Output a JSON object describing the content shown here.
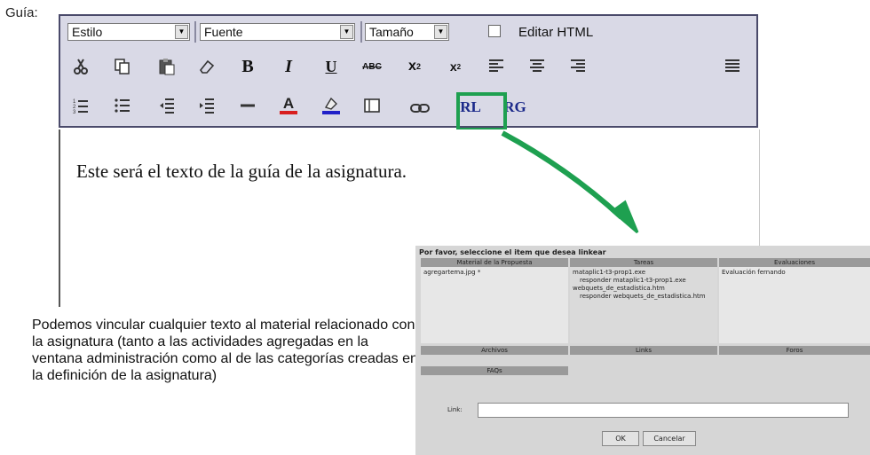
{
  "guia_label": "Guía:",
  "toolbar": {
    "style_select": "Estilo",
    "font_select": "Fuente",
    "size_select": "Tamaño",
    "edit_html_label": "Editar HTML",
    "edit_html_checked": false,
    "row1_icons": [
      "cut-icon",
      "copy-icon",
      "paste-icon",
      "eraser-icon",
      "bold-icon",
      "italic-icon",
      "underline-icon",
      "strikethrough-icon",
      "superscript-icon",
      "subscript-icon",
      "align-left-icon",
      "align-center-icon",
      "align-right-icon",
      "justify-icon"
    ],
    "row2_icons": [
      "numbered-list-icon",
      "bullet-list-icon",
      "outdent-icon",
      "indent-icon",
      "horizontal-rule-icon",
      "font-color-icon",
      "highlight-color-icon",
      "table-icon",
      "link-icon",
      "insert-resource-rl-icon",
      "insert-resource-rg-icon"
    ],
    "glyphs": {
      "bold": "B",
      "italic": "I",
      "underline": "U",
      "strike": "ABC",
      "sup_base": "x",
      "sup": "2",
      "sub_base": "x",
      "sub": "2",
      "font_color": "A",
      "rl": "RL",
      "rg": "RG"
    },
    "highlight_color": "#1ea050"
  },
  "content_text": "Este será el texto de la guía de la asignatura.",
  "caption": "Podemos vincular cualquier texto al material relacionado con la asignatura (tanto a las actividades agregadas en la ventana administración como al de las categorías creadas en la definición de la asignatura)",
  "dialog": {
    "title": "Por favor, seleccione el item que desea linkear",
    "columns": [
      {
        "header": "Material de la Propuesta",
        "items": [
          "agregartema.jpg *"
        ]
      },
      {
        "header": "Tareas",
        "items": [
          "mataplic1-t3-prop1.exe",
          "responder mataplic1-t3-prop1.exe",
          "webquets_de_estadistica.htm",
          "responder webquets_de_estadistica.htm"
        ]
      },
      {
        "header": "Evaluaciones",
        "items": [
          "Evaluación fernando"
        ]
      }
    ],
    "sections": [
      "Archivos",
      "Links",
      "Foros",
      "FAQs"
    ],
    "link_label": "Link:",
    "link_value": "",
    "ok_label": "OK",
    "cancel_label": "Cancelar"
  }
}
